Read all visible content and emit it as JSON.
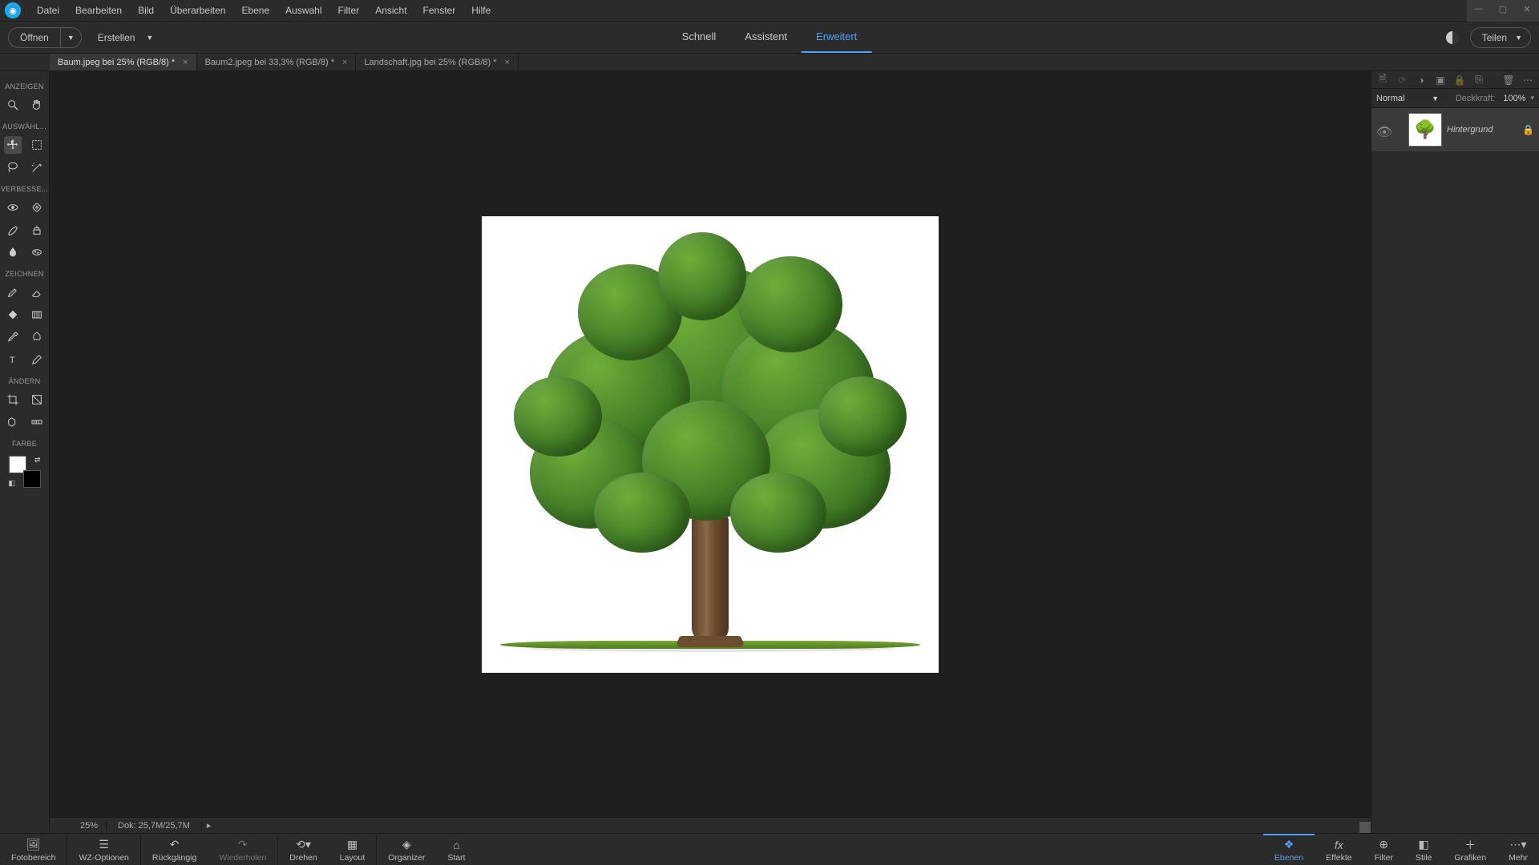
{
  "menu": [
    "Datei",
    "Bearbeiten",
    "Bild",
    "Überarbeiten",
    "Ebene",
    "Auswahl",
    "Filter",
    "Ansicht",
    "Fenster",
    "Hilfe"
  ],
  "toolbar": {
    "open": "Öffnen",
    "create": "Erstellen",
    "share": "Teilen"
  },
  "modes": {
    "quick": "Schnell",
    "guided": "Assistent",
    "expert": "Erweitert"
  },
  "tabs": [
    {
      "label": "Baum.jpeg bei 25% (RGB/8) *",
      "active": true
    },
    {
      "label": "Baum2.jpeg bei 33,3% (RGB/8) *",
      "active": false
    },
    {
      "label": "Landschaft.jpg bei 25% (RGB/8) *",
      "active": false
    }
  ],
  "tool_groups": {
    "view": "ANZEIGEN",
    "select": "AUSWÄHL...",
    "enhance": "VERBESSE...",
    "draw": "ZEICHNEN",
    "modify": "ÄNDERN",
    "color": "FARBE"
  },
  "layers": {
    "blend": "Normal",
    "opacity_label": "Deckkraft:",
    "opacity_value": "100%",
    "layer0": "Hintergrund"
  },
  "status": {
    "zoom": "25%",
    "doc": "Dok: 25,7M/25,7M"
  },
  "taskbar_left": {
    "photo_bin": "Fotobereich",
    "tool_options": "WZ-Optionen",
    "undo": "Rückgängig",
    "redo": "Wiederholen",
    "rotate": "Drehen",
    "layout": "Layout",
    "organizer": "Organizer",
    "home": "Start"
  },
  "taskbar_right": {
    "layers": "Ebenen",
    "effects": "Effekte",
    "filter": "Filter",
    "styles": "Stile",
    "graphics": "Grafiken",
    "more": "Mehr"
  }
}
